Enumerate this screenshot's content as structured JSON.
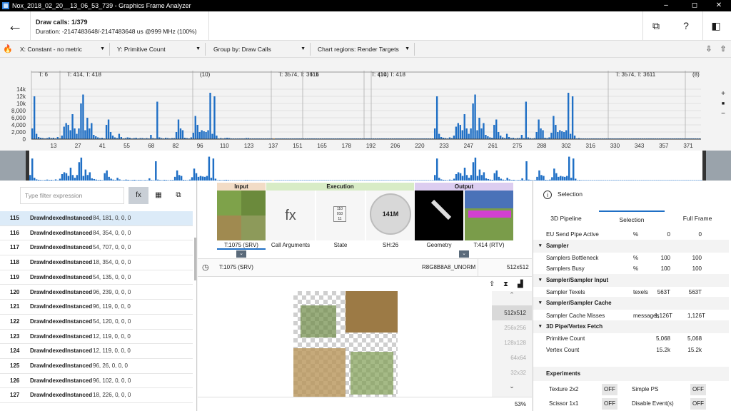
{
  "window": {
    "title": "Nox_2018_02_20__13_06_53_739 - Graphics Frame Analyzer",
    "min": "–",
    "max": "◻",
    "close": "✕"
  },
  "header": {
    "back": "←",
    "title": "Draw calls: 1/379",
    "duration": "Duration: -2147483648/-2147483648 us @999 MHz (100%)",
    "btn1": "⧉",
    "btn2": "?",
    "btn3": "◧"
  },
  "toolbar": {
    "flame": "🔥",
    "x": "X: Constant - no metric",
    "y": "Y: Primitive Count",
    "group": "Group by: Draw Calls",
    "regions": "Chart regions: Render Targets",
    "save": "⇩",
    "share": "⇧"
  },
  "chart_data": {
    "type": "bar",
    "ylabels": [
      "14k",
      "12k",
      "10k",
      "8,000",
      "6,000",
      "4,000",
      "2,000",
      "0"
    ],
    "ylim": [
      0,
      14000
    ],
    "xticks": [
      "13",
      "27",
      "41",
      "55",
      "68",
      "82",
      "96",
      "110",
      "123",
      "137",
      "151",
      "165",
      "178",
      "192",
      "206",
      "220",
      "233",
      "247",
      "261",
      "275",
      "288",
      "302",
      "316",
      "330",
      "343",
      "357",
      "371"
    ],
    "regions": [
      "T: 6",
      "T: 414, T: 418",
      "(10)",
      "T: 3574, T: 3611",
      "T: 6",
      "T: 414, T: 418",
      "(10)",
      "T: 3574, T: 3611",
      "(8)"
    ],
    "values": [
      3000,
      12000,
      1500,
      600,
      400,
      300,
      200,
      300,
      500,
      300,
      400,
      200,
      600,
      200,
      1000,
      3500,
      4500,
      4000,
      2500,
      7000,
      3000,
      1500,
      3000,
      10000,
      12500,
      2500,
      6000,
      3000,
      4500,
      1200,
      800,
      500,
      300,
      400,
      200,
      4000,
      5500,
      2000,
      1000,
      500,
      300,
      1500,
      600,
      200,
      300,
      500,
      400,
      200,
      300,
      400,
      200,
      300,
      300,
      200,
      300,
      200,
      1200,
      300,
      200,
      10500,
      500,
      300,
      200,
      400,
      300,
      200,
      300,
      300,
      2000,
      5500,
      3000,
      2500,
      400,
      300,
      200,
      500,
      1800,
      6500,
      4000,
      2000,
      2500,
      2200,
      2000,
      2500,
      13000,
      1500,
      12000,
      1000,
      200,
      300,
      200,
      300,
      400,
      300,
      200,
      200,
      200,
      200,
      200,
      200,
      200,
      300,
      300,
      200,
      200,
      200,
      200,
      200,
      200,
      200,
      200,
      200,
      200,
      200,
      200,
      200,
      200,
      200,
      200,
      200,
      200,
      200,
      200,
      200,
      200,
      200,
      200,
      200,
      200,
      200,
      200,
      200,
      200,
      200,
      200,
      200,
      200,
      200,
      200,
      200,
      200,
      200,
      200,
      200,
      200,
      200,
      200,
      200,
      200,
      200,
      200,
      200,
      200,
      200,
      200,
      200,
      200,
      200,
      200,
      200,
      200,
      200,
      200,
      200,
      200,
      200,
      200,
      200,
      200,
      200,
      200,
      200,
      200,
      200,
      200,
      200,
      200,
      200,
      200,
      200,
      200,
      200,
      200,
      200,
      200,
      200,
      200,
      200,
      200,
      200,
      3000,
      12000,
      1500,
      600,
      400,
      300,
      200,
      500,
      300,
      1000,
      3500,
      4500,
      4000,
      2500,
      7000,
      3000,
      1500,
      3000,
      10000,
      12500,
      2500,
      6000,
      3000,
      4500,
      1200,
      800,
      500,
      400,
      4000,
      5500,
      2000,
      1000,
      500,
      300,
      1500,
      600,
      300,
      400,
      200,
      300,
      300,
      1200,
      300,
      10500,
      500,
      300,
      200,
      300,
      2000,
      5500,
      3000,
      2500,
      400,
      300,
      500,
      1800,
      6500,
      4000,
      2000,
      2500,
      2200,
      2000,
      2500,
      13000,
      1500,
      12000,
      1000,
      200,
      300,
      200,
      200,
      200,
      200,
      200,
      200,
      200,
      200,
      200,
      200,
      200,
      200,
      200,
      200,
      200,
      200,
      200,
      200,
      200,
      200,
      200,
      200,
      200,
      200,
      200,
      200,
      200,
      200,
      200,
      200,
      200,
      200,
      200,
      200,
      200,
      200,
      200,
      200,
      200,
      200,
      200,
      200,
      200,
      200,
      200,
      200,
      200,
      200,
      200,
      200,
      200,
      200,
      200,
      200,
      200,
      200,
      200
    ],
    "highlight_index": 114,
    "colors": {
      "bar": "#1f6fc5",
      "highlight": "#f0a030"
    }
  },
  "chart_controls": {
    "zoomin": "+",
    "lock": "🔒",
    "zoomout": "−"
  },
  "left": {
    "filter_placeholder": "Type filter expression",
    "fx": "fx",
    "grid": "▦",
    "copy": "⧉",
    "rows": [
      {
        "id": "115",
        "name": "DrawIndexedInstanced",
        "args": "84, 181, 0, 0, 0"
      },
      {
        "id": "116",
        "name": "DrawIndexedInstanced",
        "args": "84, 354, 0, 0, 0"
      },
      {
        "id": "117",
        "name": "DrawIndexedInstanced",
        "args": "54, 707, 0, 0, 0"
      },
      {
        "id": "118",
        "name": "DrawIndexedInstanced",
        "args": "18, 354, 0, 0, 0"
      },
      {
        "id": "119",
        "name": "DrawIndexedInstanced",
        "args": "54, 135, 0, 0, 0"
      },
      {
        "id": "120",
        "name": "DrawIndexedInstanced",
        "args": "96, 239, 0, 0, 0"
      },
      {
        "id": "121",
        "name": "DrawIndexedInstanced",
        "args": "96, 119, 0, 0, 0"
      },
      {
        "id": "122",
        "name": "DrawIndexedInstanced",
        "args": "54, 120, 0, 0, 0"
      },
      {
        "id": "123",
        "name": "DrawIndexedInstanced",
        "args": "12, 119, 0, 0, 0"
      },
      {
        "id": "124",
        "name": "DrawIndexedInstanced",
        "args": "12, 119, 0, 0, 0"
      },
      {
        "id": "125",
        "name": "DrawIndexedInstanced",
        "args": "96, 26, 0, 0, 0"
      },
      {
        "id": "126",
        "name": "DrawIndexedInstanced",
        "args": "96, 102, 0, 0, 0"
      },
      {
        "id": "127",
        "name": "DrawIndexedInstanced",
        "args": "18, 226, 0, 0, 0"
      }
    ]
  },
  "pipeline": {
    "input": "Input",
    "execution": "Execution",
    "output": "Output",
    "stages": {
      "srv": "T:1075 (SRV)",
      "callargs": "Call Arguments",
      "fx": "fx",
      "state": "State",
      "sh": "SH:26",
      "sh_value": "141M",
      "geometry": "Geometry",
      "rtv": "T:414 (RTV)"
    },
    "texture": {
      "name": "T:1075 (SRV)",
      "format": "R8G8B8A8_UNORM",
      "size": "512x512"
    },
    "mips": [
      "512x512",
      "256x256",
      "128x128",
      "64x64",
      "32x32"
    ],
    "zoom": "53%"
  },
  "right": {
    "title": "Selection",
    "tabs": [
      "3D Pipeline",
      "Selection",
      "Full Frame"
    ],
    "metrics": [
      {
        "type": "row",
        "name": "EU Send Pipe Active",
        "unit": "%",
        "v1": "0",
        "v2": "0"
      },
      {
        "type": "hdr",
        "name": "Sampler"
      },
      {
        "type": "row",
        "name": "Samplers Bottleneck",
        "unit": "%",
        "v1": "100",
        "v2": "100"
      },
      {
        "type": "row",
        "name": "Samplers Busy",
        "unit": "%",
        "v1": "100",
        "v2": "100"
      },
      {
        "type": "hdr",
        "name": "Sampler/Sampler Input"
      },
      {
        "type": "row",
        "name": "Sampler Texels",
        "unit": "texels",
        "v1": "563T",
        "v2": "563T"
      },
      {
        "type": "hdr",
        "name": "Sampler/Sampler Cache"
      },
      {
        "type": "row",
        "name": "Sampler Cache Misses",
        "unit": "messages",
        "v1": "1,126T",
        "v2": "1,126T"
      },
      {
        "type": "hdr",
        "name": "3D Pipe/Vertex Fetch"
      },
      {
        "type": "row",
        "name": "Primitive Count",
        "unit": "",
        "v1": "5,068",
        "v2": "5,068"
      },
      {
        "type": "row",
        "name": "Vertex Count",
        "unit": "",
        "v1": "15.2k",
        "v2": "15.2k"
      }
    ],
    "experiments": {
      "title": "Experiments",
      "items": [
        {
          "name": "Texture 2x2",
          "state": "OFF"
        },
        {
          "name": "Simple PS",
          "state": "OFF"
        },
        {
          "name": "Scissor 1x1",
          "state": "OFF"
        },
        {
          "name": "Disable Event(s)",
          "state": "OFF"
        }
      ]
    }
  }
}
